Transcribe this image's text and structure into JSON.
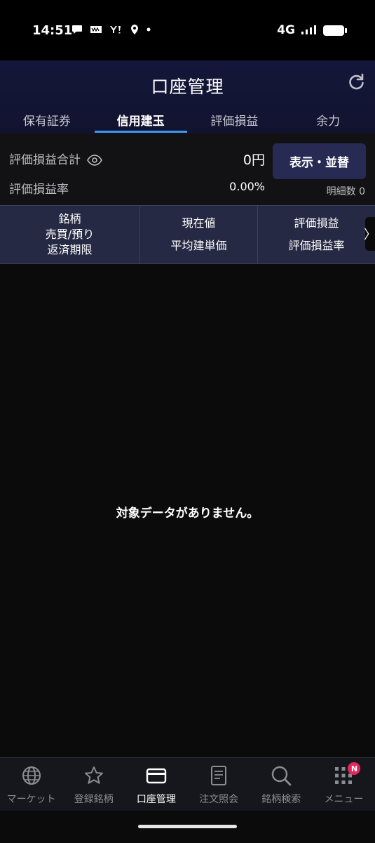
{
  "status_bar": {
    "time": "14:51",
    "network": "4G",
    "icons": [
      "chat-icon",
      "news-icon",
      "yahoo-icon",
      "location-icon",
      "dot-icon"
    ]
  },
  "header": {
    "title": "口座管理"
  },
  "tabs": [
    {
      "label": "保有証券",
      "active": false
    },
    {
      "label": "信用建玉",
      "active": true
    },
    {
      "label": "評価損益",
      "active": false
    },
    {
      "label": "余力",
      "active": false
    }
  ],
  "summary": {
    "total_label": "評価損益合計",
    "total_value": "0円",
    "rate_label": "評価損益率",
    "rate_value": "0.00%",
    "sort_button": "表示・並替",
    "detail_count": "明細数 0"
  },
  "table_header": {
    "col1": [
      "銘柄",
      "売買/預り",
      "返済期限"
    ],
    "col2": [
      "現在値",
      "平均建単価"
    ],
    "col3": [
      "評価損益",
      "評価損益率"
    ],
    "scroll": "〉"
  },
  "empty_message": "対象データがありません。",
  "bottom_nav": [
    {
      "label": "マーケット",
      "icon": "globe-icon",
      "active": false
    },
    {
      "label": "登録銘柄",
      "icon": "star-icon",
      "active": false
    },
    {
      "label": "口座管理",
      "icon": "card-icon",
      "active": true
    },
    {
      "label": "注文照会",
      "icon": "document-icon",
      "active": false
    },
    {
      "label": "銘柄検索",
      "icon": "search-icon",
      "active": false
    },
    {
      "label": "メニュー",
      "icon": "grid-icon",
      "active": false,
      "badge": "N"
    }
  ],
  "colors": {
    "accent": "#3d9be9",
    "header_bg": "#15173a",
    "button_bg": "#272a52",
    "badge": "#e8255a"
  }
}
